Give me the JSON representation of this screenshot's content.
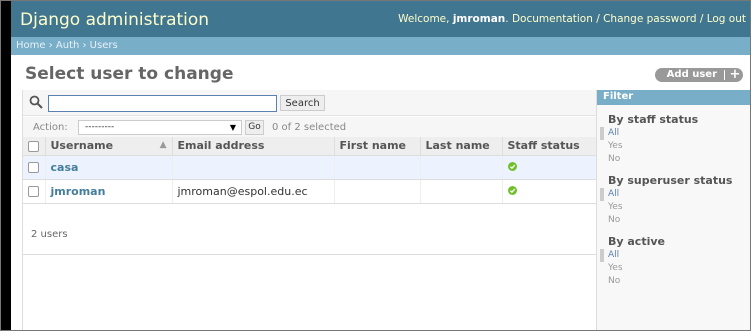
{
  "header": {
    "brand": "Django administration",
    "welcome": "Welcome, ",
    "username": "jmroman",
    "links": ". Documentation / Change password / Log out"
  },
  "breadcrumbs": "Home › Auth › Users",
  "page": {
    "title": "Select user to change",
    "add_user_label": "Add user",
    "add_user_plus": "+"
  },
  "search": {
    "value": "",
    "button_label": "Search"
  },
  "actions": {
    "label": "Action:",
    "selected_value": "---------",
    "go_label": "Go",
    "selected_count": "0 of 2 selected"
  },
  "table": {
    "columns": [
      "Username",
      "Email address",
      "First name",
      "Last name",
      "Staff status"
    ],
    "rows": [
      {
        "username": "casa",
        "email": "",
        "first_name": "",
        "last_name": "",
        "staff_status": true
      },
      {
        "username": "jmroman",
        "email": "jmroman@espol.edu.ec",
        "first_name": "",
        "last_name": "",
        "staff_status": true
      }
    ],
    "sort_indicator": "▲"
  },
  "paginator": "2 users",
  "filter": {
    "title": "Filter",
    "groups": [
      {
        "title": "By staff status",
        "options": [
          "All",
          "Yes",
          "No"
        ],
        "selected": "All"
      },
      {
        "title": "By superuser status",
        "options": [
          "All",
          "Yes",
          "No"
        ],
        "selected": "All"
      },
      {
        "title": "By active",
        "options": [
          "All",
          "Yes",
          "No"
        ],
        "selected": "All"
      }
    ]
  },
  "colors": {
    "header_bg": "#417690",
    "brand_text": "#ffffcc",
    "breadcrumbs_bg": "#79aec8",
    "link": "#447e9b",
    "ok_icon": "#70bf2b"
  }
}
